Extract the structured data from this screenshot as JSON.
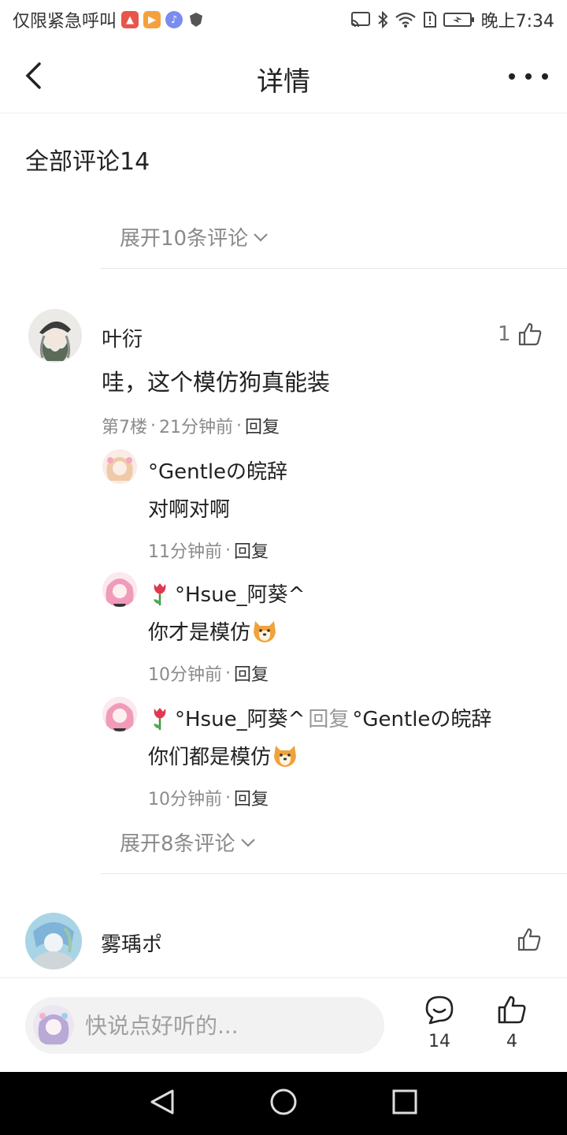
{
  "status_bar": {
    "carrier_text": "仅限紧急呼叫",
    "time": "晚上7:34"
  },
  "nav": {
    "title": "详情"
  },
  "section": {
    "title": "全部评论14",
    "expand_top": "展开10条评论"
  },
  "comment1": {
    "username": "叶衍",
    "like_count": "1",
    "text": "哇，这个模仿狗真能装",
    "floor": "第7楼",
    "time": "21分钟前",
    "reply_label": "回复",
    "replies": [
      {
        "username": "°Gentleの皖辞",
        "text": "对啊对啊",
        "time": "11分钟前",
        "reply_label": "回复"
      },
      {
        "username": "°Hsue_阿葵^",
        "text": "你才是模仿",
        "time": "10分钟前",
        "reply_label": "回复"
      },
      {
        "username": "°Hsue_阿葵^",
        "reply_word": "回复",
        "reply_to": "°Gentleの皖辞",
        "text": "你们都是模仿",
        "time": "10分钟前",
        "reply_label": "回复"
      }
    ],
    "expand_more": "展开8条评论"
  },
  "comment2": {
    "username": "雾瑀ポ"
  },
  "bottom_bar": {
    "placeholder": "快说点好听的...",
    "comment_count": "14",
    "like_count": "4"
  },
  "colors": {
    "primary_text": "#222222",
    "secondary_text": "#8a8a8a",
    "divider": "#e8e8e8",
    "input_bg": "#f2f2f2"
  }
}
